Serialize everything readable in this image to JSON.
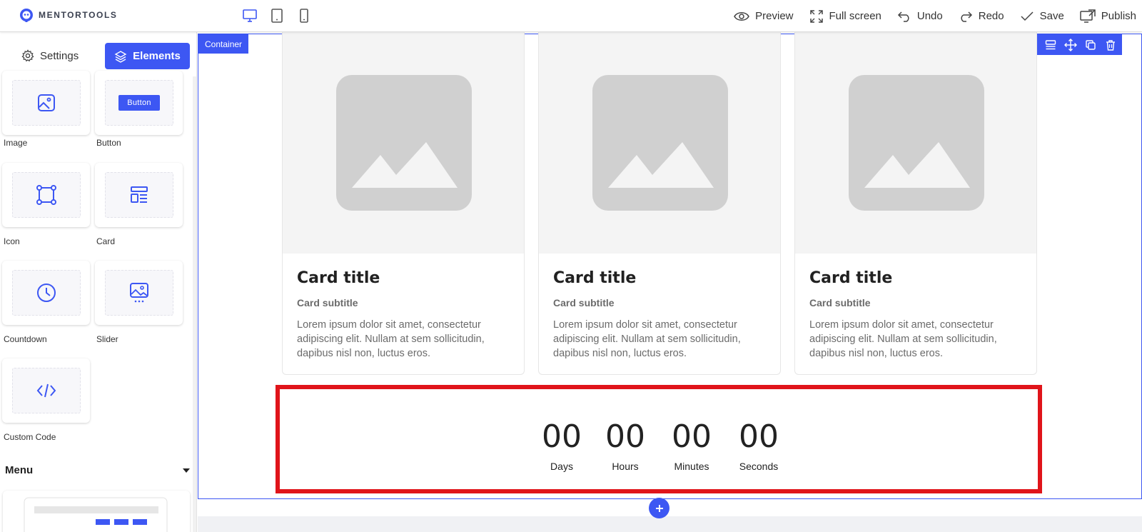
{
  "app": {
    "logo_text": "MENTORTOOLS"
  },
  "devices": [
    "desktop",
    "tablet",
    "mobile"
  ],
  "actions": {
    "preview": "Preview",
    "fullscreen": "Full screen",
    "undo": "Undo",
    "redo": "Redo",
    "save": "Save",
    "publish": "Publish"
  },
  "sidebar": {
    "tabs": {
      "settings": "Settings",
      "elements": "Elements"
    },
    "elements": [
      {
        "label": "Image",
        "icon": "image-icon"
      },
      {
        "label": "Button",
        "icon": "button-sample",
        "sample_text": "Button"
      },
      {
        "label": "Icon",
        "icon": "vector-square-icon"
      },
      {
        "label": "Card",
        "icon": "card-layout-icon"
      },
      {
        "label": "Countdown",
        "icon": "clock-icon"
      },
      {
        "label": "Slider",
        "icon": "slider-image-icon"
      },
      {
        "label": "Custom Code",
        "icon": "code-icon"
      }
    ],
    "menu_section": {
      "title": "Menu"
    }
  },
  "canvas": {
    "container_tag": "Container",
    "cards": [
      {
        "title": "Card title",
        "subtitle": "Card subtitle",
        "text": "Lorem ipsum dolor sit amet, consectetur adipiscing elit. Nullam at sem sollicitudin, dapibus nisl non, luctus eros."
      },
      {
        "title": "Card title",
        "subtitle": "Card subtitle",
        "text": "Lorem ipsum dolor sit amet, consectetur adipiscing elit. Nullam at sem sollicitudin, dapibus nisl non, luctus eros."
      },
      {
        "title": "Card title",
        "subtitle": "Card subtitle",
        "text": "Lorem ipsum dolor sit amet, consectetur adipiscing elit. Nullam at sem sollicitudin, dapibus nisl non, luctus eros."
      }
    ],
    "countdown": {
      "units": [
        {
          "value": "00",
          "label": "Days"
        },
        {
          "value": "00",
          "label": "Hours"
        },
        {
          "value": "00",
          "label": "Minutes"
        },
        {
          "value": "00",
          "label": "Seconds"
        }
      ]
    }
  },
  "colors": {
    "accent": "#3d57f3",
    "highlight": "#e0141a",
    "placeholder_bg": "#f4f4f4",
    "placeholder_icon": "#d0d0d0"
  }
}
